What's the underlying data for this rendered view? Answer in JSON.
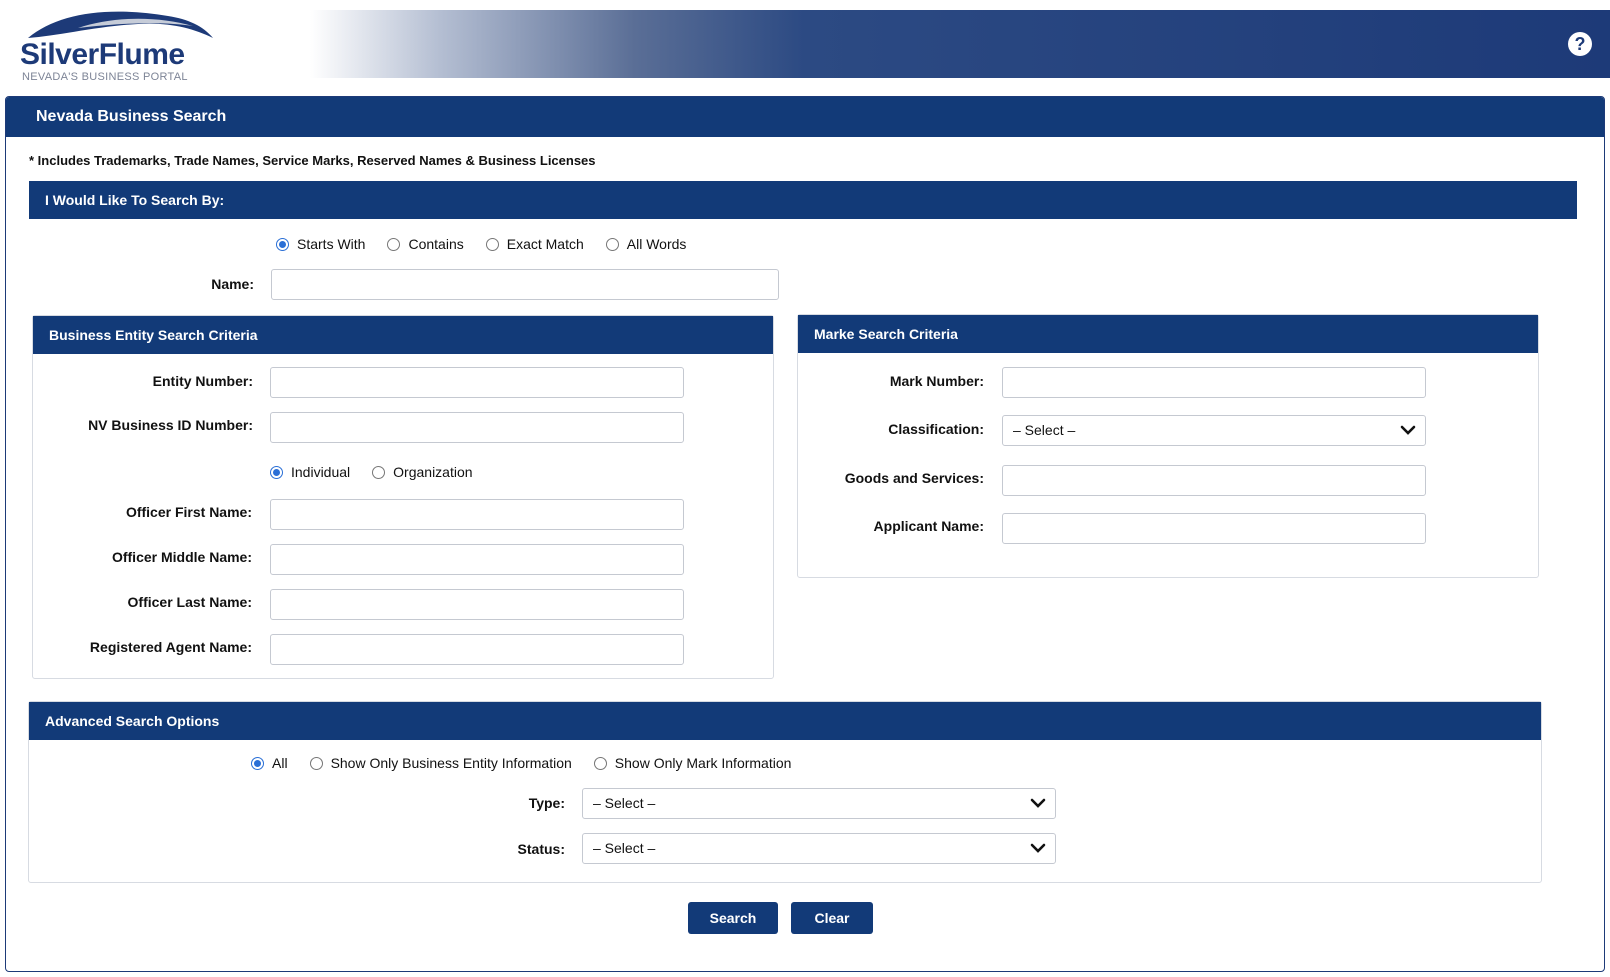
{
  "header": {
    "logo_title": "SilverFlume",
    "logo_subtitle": "NEVADA'S BUSINESS PORTAL",
    "help_symbol": "?"
  },
  "main": {
    "title": "Nevada Business Search",
    "note": "* Includes Trademarks, Trade Names, Service Marks, Reserved Names & Business Licenses"
  },
  "search_by": {
    "title": "I Would Like To Search By:",
    "options": [
      "Starts With",
      "Contains",
      "Exact Match",
      "All Words"
    ],
    "selected": "Starts With",
    "name_label": "Name:",
    "name_value": ""
  },
  "entity": {
    "title": "Business Entity Search Criteria",
    "entity_number_label": "Entity Number:",
    "nv_id_label": "NV Business ID Number:",
    "type_options": [
      "Individual",
      "Organization"
    ],
    "type_selected": "Individual",
    "officer_first_label": "Officer First Name:",
    "officer_middle_label": "Officer Middle Name:",
    "officer_last_label": "Officer Last Name:",
    "agent_label": "Registered Agent Name:"
  },
  "mark": {
    "title": "Marke Search Criteria",
    "mark_number_label": "Mark Number:",
    "classification_label": "Classification:",
    "classification_value": "– Select –",
    "goods_label": "Goods and Services:",
    "applicant_label": "Applicant Name:"
  },
  "advanced": {
    "title": "Advanced Search Options",
    "options": [
      "All",
      "Show Only Business Entity Information",
      "Show Only Mark Information"
    ],
    "selected": "All",
    "type_label": "Type:",
    "type_value": "– Select –",
    "status_label": "Status:",
    "status_value": "– Select –"
  },
  "buttons": {
    "search": "Search",
    "clear": "Clear"
  },
  "colors": {
    "primary": "#123a78",
    "radio_accent": "#2a6fd6"
  }
}
